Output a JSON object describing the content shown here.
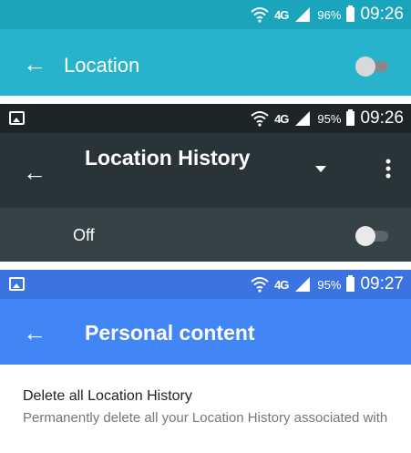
{
  "shot1": {
    "status": {
      "battery": "96%",
      "time": "09:26",
      "network": "4G"
    },
    "title": "Location",
    "toggle_on": false
  },
  "shot2": {
    "status": {
      "battery": "95%",
      "time": "09:26",
      "network": "4G"
    },
    "title": "Location History",
    "off_label": "Off",
    "toggle_on": false
  },
  "shot3": {
    "status": {
      "battery": "95%",
      "time": "09:27",
      "network": "4G"
    },
    "title": "Personal content",
    "item": {
      "title": "Delete all Location History",
      "subtitle": "Permanently delete all your Location History associated with"
    }
  },
  "icons": [
    "wifi-icon",
    "signal-icon",
    "battery-icon",
    "back-arrow-icon",
    "gallery-icon",
    "dropdown-icon",
    "more-vert-icon"
  ],
  "colors": {
    "shot1_appbar": "#27b3cc",
    "shot2_appbar": "#29343a",
    "shot3_appbar": "#4285f4"
  }
}
